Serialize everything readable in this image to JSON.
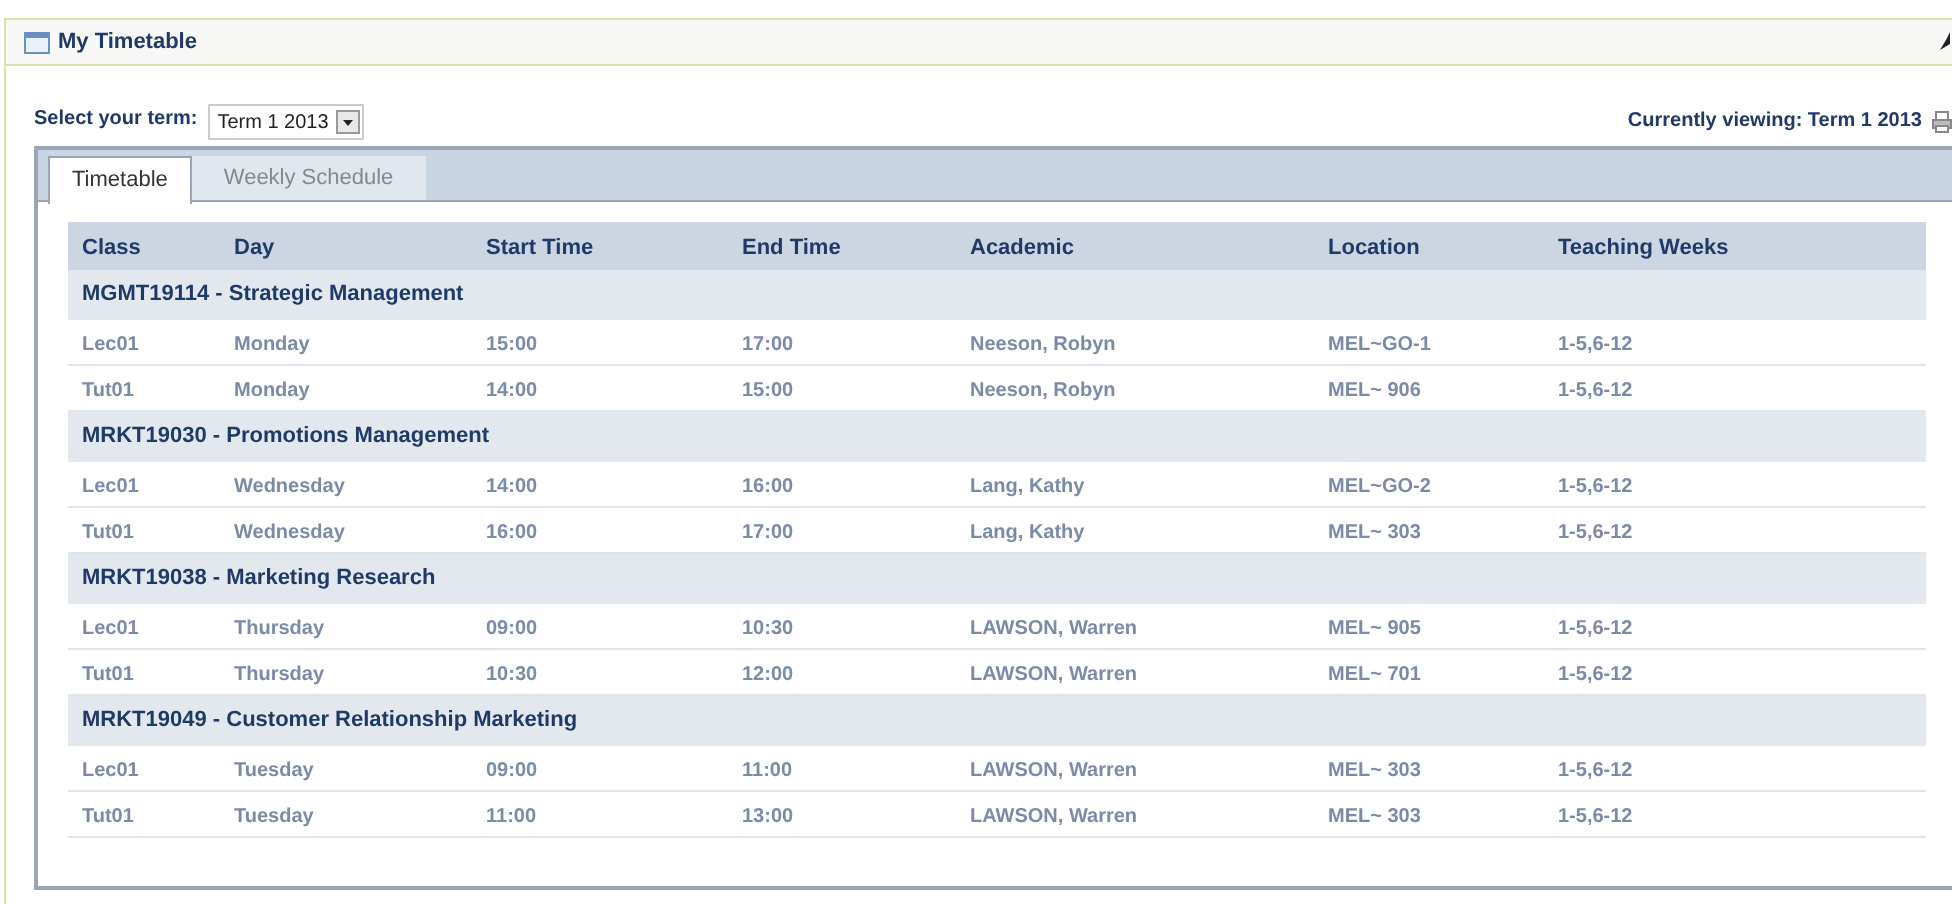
{
  "panel": {
    "title": "My Timetable"
  },
  "term_select": {
    "label": "Select your term:",
    "value": "Term 1 2013"
  },
  "currently_viewing": "Currently viewing: Term 1 2013",
  "tabs": [
    {
      "label": "Timetable",
      "selected": true
    },
    {
      "label": "Weekly Schedule",
      "selected": false
    }
  ],
  "table": {
    "columns": [
      "Class",
      "Day",
      "Start Time",
      "End Time",
      "Academic",
      "Location",
      "Teaching Weeks"
    ],
    "groups": [
      {
        "title": "MGMT19114 - Strategic Management",
        "rows": [
          [
            "Lec01",
            "Monday",
            "15:00",
            "17:00",
            "Neeson, Robyn",
            "MEL~GO-1",
            "1-5,6-12"
          ],
          [
            "Tut01",
            "Monday",
            "14:00",
            "15:00",
            "Neeson, Robyn",
            "MEL~ 906",
            "1-5,6-12"
          ]
        ]
      },
      {
        "title": "MRKT19030 - Promotions Management",
        "rows": [
          [
            "Lec01",
            "Wednesday",
            "14:00",
            "16:00",
            "Lang, Kathy",
            "MEL~GO-2",
            "1-5,6-12"
          ],
          [
            "Tut01",
            "Wednesday",
            "16:00",
            "17:00",
            "Lang, Kathy",
            "MEL~ 303",
            "1-5,6-12"
          ]
        ]
      },
      {
        "title": "MRKT19038 - Marketing Research",
        "rows": [
          [
            "Lec01",
            "Thursday",
            "09:00",
            "10:30",
            "LAWSON, Warren",
            "MEL~ 905",
            "1-5,6-12"
          ],
          [
            "Tut01",
            "Thursday",
            "10:30",
            "12:00",
            "LAWSON, Warren",
            "MEL~ 701",
            "1-5,6-12"
          ]
        ]
      },
      {
        "title": "MRKT19049 - Customer Relationship Marketing",
        "rows": [
          [
            "Lec01",
            "Tuesday",
            "09:00",
            "11:00",
            "LAWSON, Warren",
            "MEL~ 303",
            "1-5,6-12"
          ],
          [
            "Tut01",
            "Tuesday",
            "11:00",
            "13:00",
            "LAWSON, Warren",
            "MEL~ 303",
            "1-5,6-12"
          ]
        ]
      }
    ]
  }
}
